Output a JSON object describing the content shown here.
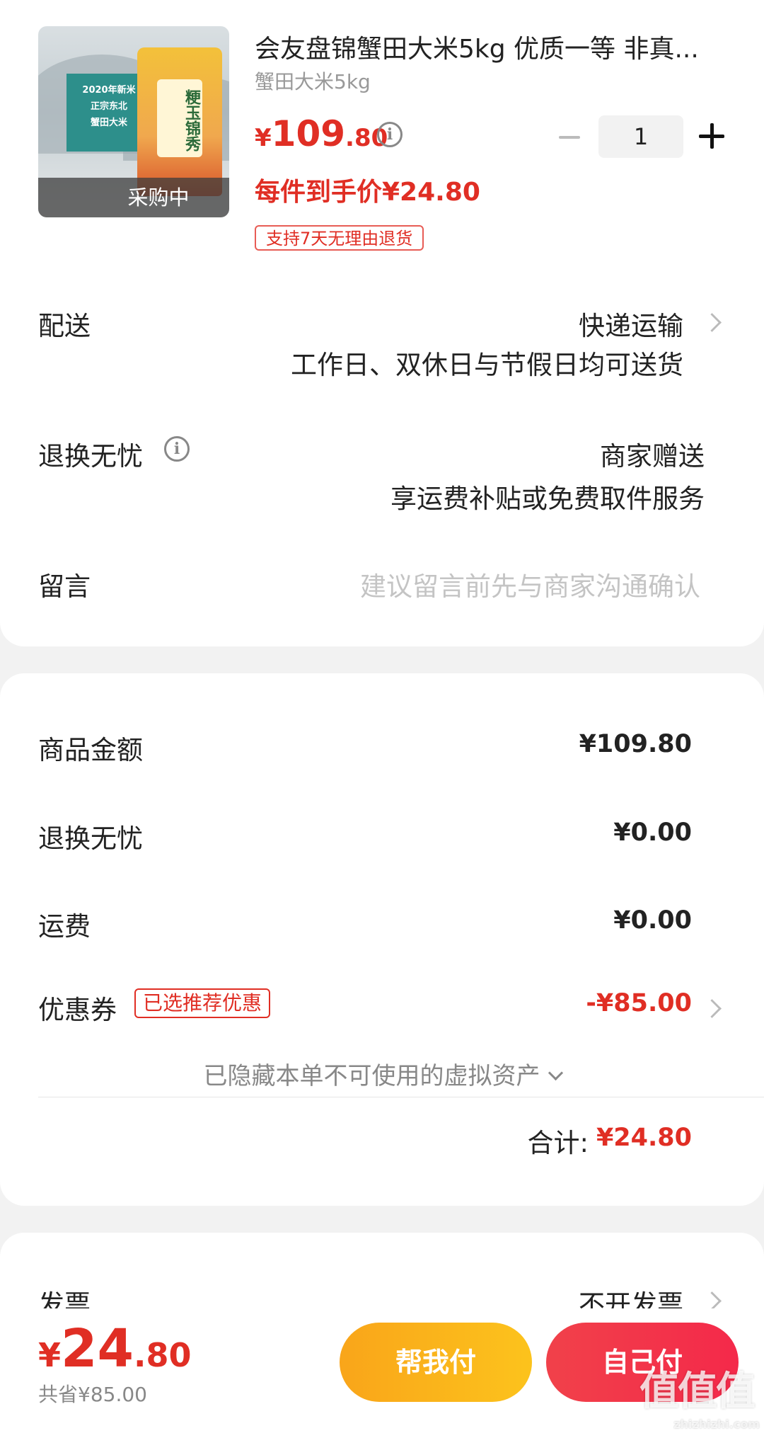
{
  "product": {
    "thumb_badge": "采购中",
    "thumb_banner_lines": [
      "2020年新米",
      "正宗东北",
      "蟹田大米"
    ],
    "thumb_bag_label": "粳玉锦秀",
    "title": "会友盘锦蟹田大米5kg 优质一等 非真...",
    "spec": "蟹田大米5kg",
    "price_currency": "¥",
    "price_integer": "109",
    "price_decimal": ".80",
    "unit_price": "每件到手价¥24.80",
    "return_tag": "支持7天无理由退货",
    "quantity": "1"
  },
  "delivery": {
    "label": "配送",
    "method": "快递运输",
    "note": "工作日、双休日与节假日均可送货"
  },
  "worry_free": {
    "label": "退换无忧",
    "value": "商家赠送",
    "note": "享运费补贴或免费取件服务"
  },
  "message": {
    "label": "留言",
    "placeholder": "建议留言前先与商家沟通确认"
  },
  "fees": {
    "goods_label": "商品金额",
    "goods_value": "¥109.80",
    "worry_free_label": "退换无忧",
    "worry_free_value": "¥0.00",
    "shipping_label": "运费",
    "shipping_value": "¥0.00",
    "coupon_label": "优惠券",
    "coupon_tag": "已选推荐优惠",
    "coupon_value": "-¥85.00",
    "hidden_assets": "已隐藏本单不可使用的虚拟资产",
    "total_label": "合计:",
    "total_value": "¥24.80"
  },
  "invoice": {
    "label": "发票",
    "value": "不开发票"
  },
  "bottom_bar": {
    "price_currency": "¥",
    "price_integer": "24",
    "price_decimal": ".80",
    "saved": "共省¥85.00",
    "pay_friend": "帮我付",
    "pay_self": "自己付"
  },
  "watermark": {
    "logo": "值值值",
    "site": "zhizhizhi.com"
  },
  "colors": {
    "accent_red": "#e02e24",
    "button_orange": "#fbb61b",
    "button_red": "#f2354a"
  }
}
